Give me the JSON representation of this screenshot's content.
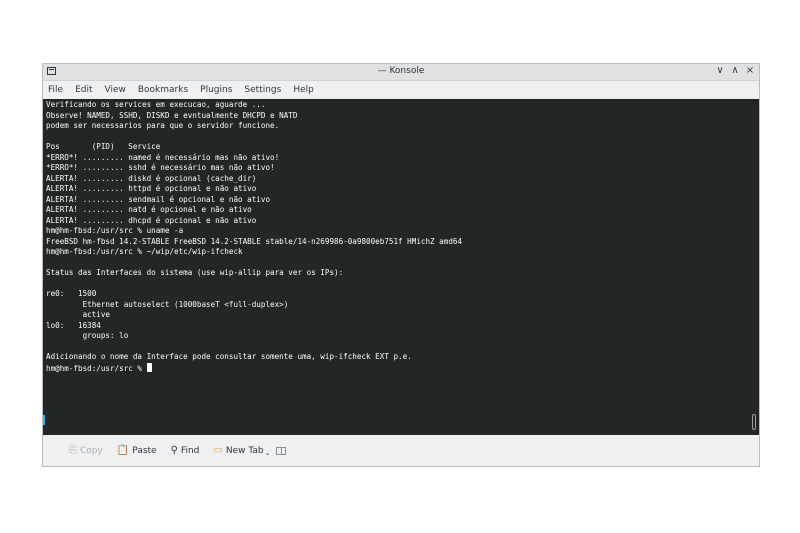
{
  "window": {
    "title": "— Konsole"
  },
  "window_controls": {
    "minimize": "∨",
    "maximize": "∧",
    "close": "×"
  },
  "menu": [
    "File",
    "Edit",
    "View",
    "Bookmarks",
    "Plugins",
    "Settings",
    "Help"
  ],
  "terminal": {
    "lines": [
      "Verificando os services em execucao, aguarde ...",
      "Observe! NAMED, SSHD, DISKD e evntualmente DHCPD e NATD",
      "podem ser necessarios para que o servidor funcione.",
      "",
      "Pos       (PID)   Service",
      "*ERRO*! ......... named é necessário mas não ativo!",
      "*ERRO*! ......... sshd é necessário mas não ativo!",
      "ALERTA! ......... diskd é opcional (cache_dir)",
      "ALERTA! ......... httpd é opcional e não ativo",
      "ALERTA! ......... sendmail é opcional e não ativo",
      "ALERTA! ......... natd é opcional e não ativo",
      "ALERTA! ......... dhcpd é opcional e não ativo",
      "hm@hm-fbsd:/usr/src % uname -a",
      "FreeBSD hm-fbsd 14.2-STABLE FreeBSD 14.2-STABLE stable/14-n269986-0a9800eb751f HMichZ amd64",
      "hm@hm-fbsd:/usr/src % ~/wip/etc/wip-ifcheck",
      "",
      "Status das Interfaces do sistema (use wip-allip para ver os IPs):",
      "",
      "re0:   1500",
      "        Ethernet autoselect (1000baseT <full-duplex>)",
      "        active",
      "lo0:   16384",
      "        groups: lo",
      "",
      "Adicionando o nome da Interface pode consultar somente uma, wip-ifcheck EXT p.e."
    ],
    "prompt": "hm@hm-fbsd:/usr/src % "
  },
  "toolbar": {
    "copy": "Copy",
    "paste": "Paste",
    "find": "Find",
    "new_tab": "New Tab"
  },
  "colors": {
    "terminal_bg": "#232627",
    "terminal_fg": "#fcfcfc",
    "accent": "#3daee9"
  }
}
